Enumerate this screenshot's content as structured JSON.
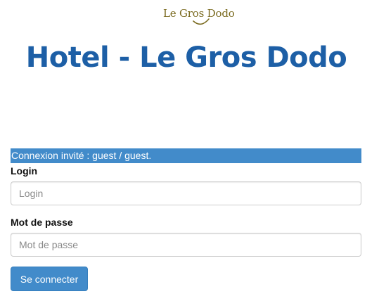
{
  "logo": {
    "text": "Le Gros Dodo",
    "color": "#7a6a1f"
  },
  "header": {
    "title": "Hotel - Le Gros Dodo",
    "title_color": "#1d5fa6"
  },
  "banner": {
    "text": "Connexion invité : guest / guest.",
    "background": "#428bca"
  },
  "form": {
    "login": {
      "label": "Login",
      "placeholder": "Login",
      "value": ""
    },
    "password": {
      "label": "Mot de passe",
      "placeholder": "Mot de passe",
      "value": ""
    },
    "submit_label": "Se connecter",
    "submit_color": "#428bca"
  }
}
